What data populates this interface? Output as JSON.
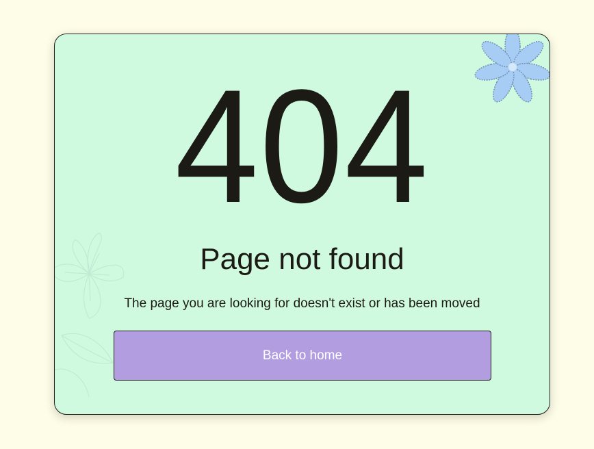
{
  "error": {
    "code": "404",
    "title": "Page not found",
    "message": "The page you are looking for doesn't exist or has been moved"
  },
  "actions": {
    "back_home_label": "Back to home"
  },
  "colors": {
    "page_background": "#fefde8",
    "card_background": "#cffadf",
    "button_background": "#b29de0",
    "flower_accent": "#a8cdf5"
  },
  "decor": {
    "corner_icon": "flower-icon",
    "faint_icon": "lily-outline-icon"
  }
}
